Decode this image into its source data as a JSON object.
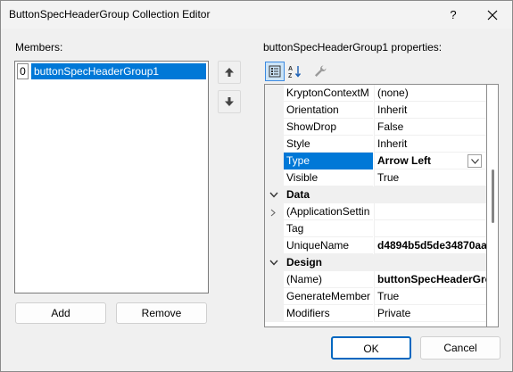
{
  "window": {
    "title": "ButtonSpecHeaderGroup Collection Editor",
    "help_label": "?"
  },
  "members": {
    "label": "Members:",
    "items": [
      {
        "index": "0",
        "name": "buttonSpecHeaderGroup1"
      }
    ],
    "add_label": "Add",
    "remove_label": "Remove"
  },
  "properties": {
    "label": "buttonSpecHeaderGroup1 properties:",
    "rows": [
      {
        "kind": "prop",
        "name": "KryptonContextM",
        "value": "(none)"
      },
      {
        "kind": "prop",
        "name": "Orientation",
        "value": "Inherit"
      },
      {
        "kind": "prop",
        "name": "ShowDrop",
        "value": "False"
      },
      {
        "kind": "prop",
        "name": "Style",
        "value": "Inherit"
      },
      {
        "kind": "prop",
        "name": "Type",
        "value": "Arrow Left",
        "selected": true
      },
      {
        "kind": "prop",
        "name": "Visible",
        "value": "True"
      },
      {
        "kind": "category",
        "name": "Data"
      },
      {
        "kind": "prop",
        "name": "(ApplicationSettin",
        "value": ""
      },
      {
        "kind": "prop",
        "name": "Tag",
        "value": ""
      },
      {
        "kind": "prop",
        "name": "UniqueName",
        "value": "d4894b5d5de34870aa"
      },
      {
        "kind": "category",
        "name": "Design"
      },
      {
        "kind": "prop",
        "name": "(Name)",
        "value": "buttonSpecHeaderGro"
      },
      {
        "kind": "prop",
        "name": "GenerateMember",
        "value": "True"
      },
      {
        "kind": "prop",
        "name": "Modifiers",
        "value": "Private"
      }
    ]
  },
  "footer": {
    "ok_label": "OK",
    "cancel_label": "Cancel"
  }
}
